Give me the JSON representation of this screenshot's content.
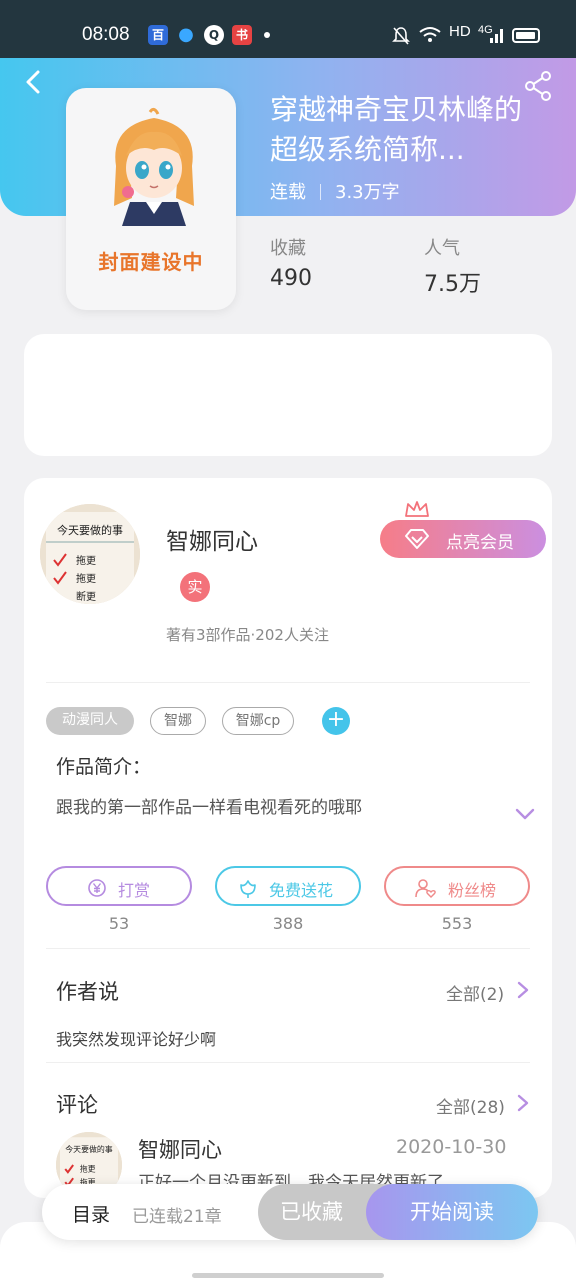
{
  "status_bar": {
    "time": "08:08",
    "network": "HD",
    "signal": "4G",
    "app_icons": [
      "baidu-icon",
      "qq-icon",
      "q-icon",
      "ebook-icon"
    ]
  },
  "header": {
    "title": "穿越神奇宝贝林峰的超级系统简称...",
    "status": "连载",
    "word_count": "3.3万字",
    "cover_caption": "封面建设中",
    "stats": [
      {
        "label": "收藏",
        "value": "490"
      },
      {
        "label": "人气",
        "value": "7.5万"
      }
    ]
  },
  "author": {
    "name": "智娜同心",
    "verified_badge": "实",
    "stats": "著有3部作品·202人关注",
    "vip_button": "点亮会员",
    "avatar_text": [
      "今天要做的事",
      "拖更",
      "拖更",
      "断更"
    ]
  },
  "tags": [
    "动漫同人",
    "智娜",
    "智娜cp"
  ],
  "intro": {
    "title": "作品简介：",
    "text": "跟我的第一部作品一样看电视看死的哦耶"
  },
  "actions": [
    {
      "label": "打赏",
      "count": "53",
      "color": "#b58be0"
    },
    {
      "label": "免费送花",
      "count": "388",
      "color": "#4cc8e6"
    },
    {
      "label": "粉丝榜",
      "count": "553",
      "color": "#ef8a8a"
    }
  ],
  "author_say": {
    "title": "作者说",
    "more": "全部(2)",
    "text": "我突然发现评论好少啊"
  },
  "comments": {
    "title": "评论",
    "more": "全部(28)",
    "first": {
      "name": "智娜同心",
      "date": "2020-10-30",
      "text": "正好一个月没更新到，我今天居然更新了"
    }
  },
  "bottom_bar": {
    "toc": "目录",
    "chapters": "已连载21章",
    "collected": "已收藏",
    "read": "开始阅读"
  },
  "colors": {
    "header_gradient": [
      "#45c7ef",
      "#c29ae6"
    ],
    "vip_gradient": [
      "#f67d88",
      "#cb8fe0"
    ],
    "read_gradient": [
      "#a796ee",
      "#7cc7f1"
    ]
  }
}
